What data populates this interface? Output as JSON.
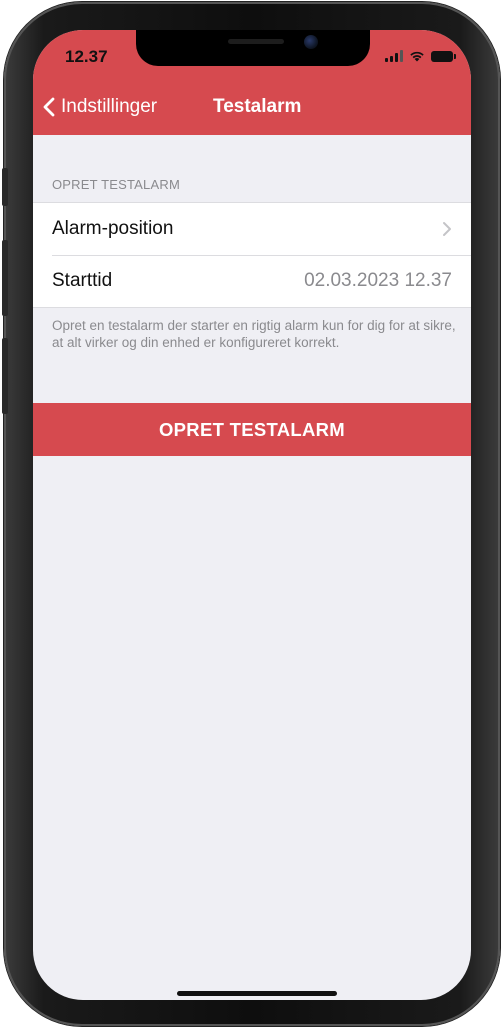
{
  "status_bar": {
    "time": "12.37",
    "icons": [
      "cellular-signal-icon",
      "wifi-icon",
      "battery-icon"
    ]
  },
  "nav": {
    "back_label": "Indstillinger",
    "back_icon": "chevron-left-icon",
    "title": "Testalarm"
  },
  "section": {
    "header": "OPRET TESTALARM",
    "rows": [
      {
        "label": "Alarm-position",
        "value": "",
        "accessory": "chevron-right-icon"
      },
      {
        "label": "Starttid",
        "value": "02.03.2023 12.37"
      }
    ],
    "footnote": "Opret en testalarm der starter en rigtig alarm kun for dig for at sikre, at alt virker og din enhed er konfigureret korrekt."
  },
  "primary_button": {
    "label": "OPRET TESTALARM"
  },
  "colors": {
    "accent": "#d64a4f",
    "background": "#efeff4",
    "secondary_text": "#8a8a8e"
  }
}
